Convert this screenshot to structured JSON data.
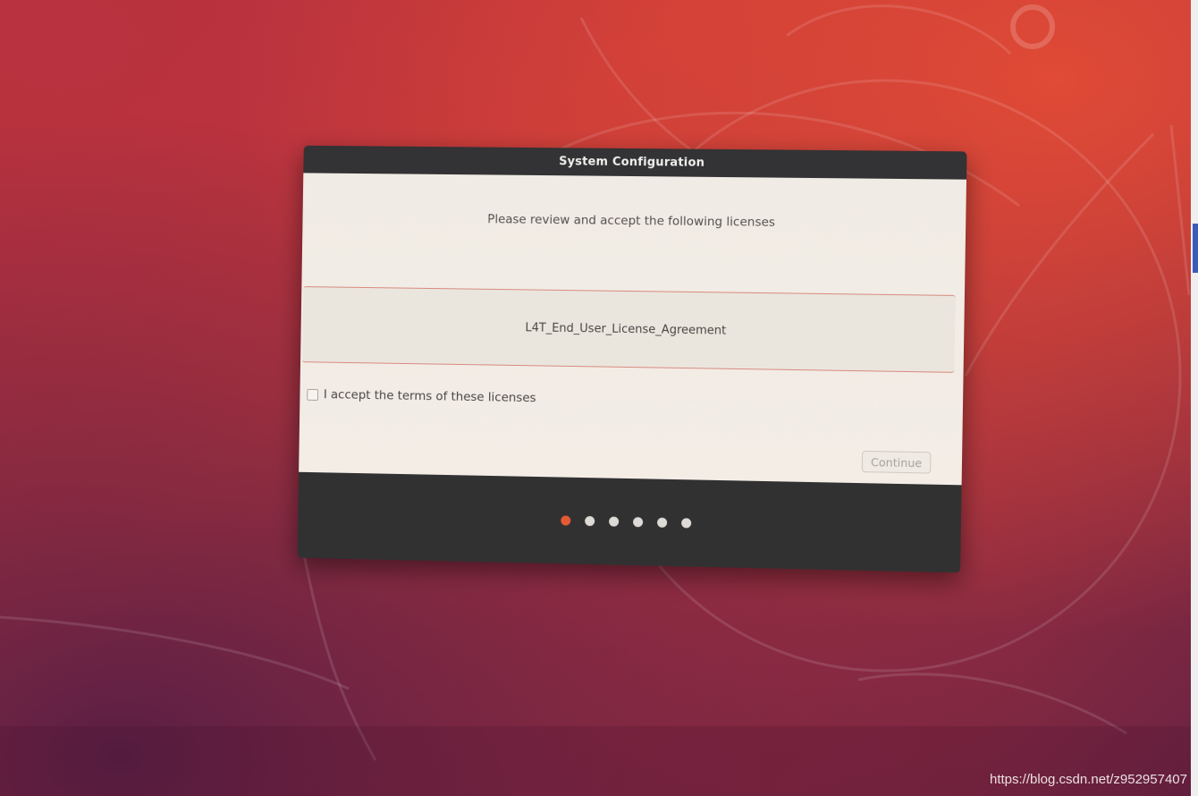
{
  "dialog": {
    "title": "System Configuration",
    "instruction": "Please review and accept the following licenses",
    "licenses": [
      "L4T_End_User_License_Agreement"
    ],
    "accept_label": "I accept the terms of these licenses",
    "accept_checked": false,
    "continue_label": "Continue",
    "continue_enabled": false,
    "progress": {
      "total_steps": 6,
      "current_step": 1
    }
  },
  "watermark": "https://blog.csdn.net/z952957407",
  "colors": {
    "accent": "#e45a35",
    "titlebar": "#333234",
    "content_bg": "#f0ebe4",
    "footer": "#323132",
    "wallpaper": "#c93a39"
  }
}
